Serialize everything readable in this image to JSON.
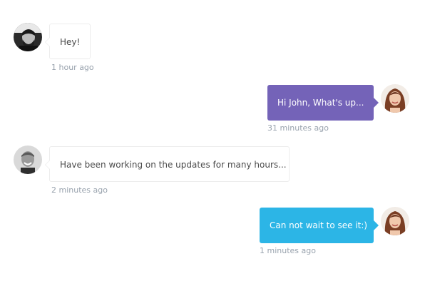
{
  "colors": {
    "purple_bubble": "#7463b8",
    "blue_bubble": "#2cb5e6",
    "timestamp": "#98a2ad",
    "incoming_text": "#4a4a4a"
  },
  "messages": [
    {
      "side": "incoming",
      "avatar": "man-beard-avatar",
      "text": "Hey!",
      "time": "1 hour ago"
    },
    {
      "side": "outgoing",
      "avatar": "woman-avatar",
      "text": "Hi John, What's up...",
      "time": "31 minutes ago"
    },
    {
      "side": "incoming",
      "avatar": "man-smiling-avatar",
      "text": "Have been working on the updates for many hours...",
      "time": "2 minutes ago"
    },
    {
      "side": "outgoing",
      "avatar": "woman-avatar",
      "text": "Can not wait to see it:)",
      "time": "1 minutes ago"
    }
  ]
}
